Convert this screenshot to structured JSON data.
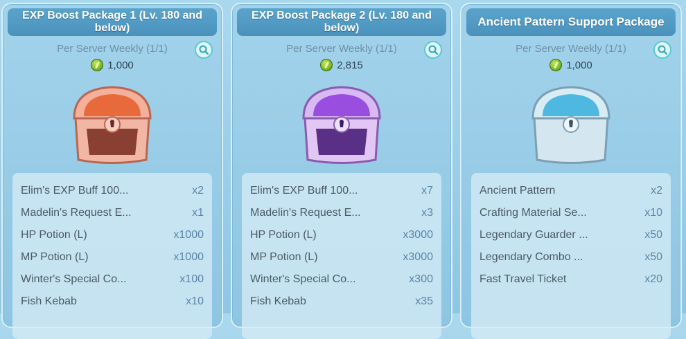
{
  "packages": [
    {
      "title": "EXP Boost Package 1 (Lv. 180 and below)",
      "limit": "Per Server Weekly (1/1)",
      "price": "1,000",
      "chest_color": "#f08060",
      "items": [
        {
          "name": "Elim's EXP Buff 100...",
          "qty": "x2"
        },
        {
          "name": "Madelin's Request E...",
          "qty": "x1"
        },
        {
          "name": "HP Potion (L)",
          "qty": "x1000"
        },
        {
          "name": "MP Potion (L)",
          "qty": "x1000"
        },
        {
          "name": "Winter's Special Co...",
          "qty": "x100"
        },
        {
          "name": "Fish Kebab",
          "qty": "x10"
        }
      ]
    },
    {
      "title": "EXP Boost Package 2 (Lv. 180 and below)",
      "limit": "Per Server Weekly (1/1)",
      "price": "2,815",
      "chest_color": "#b670e6",
      "items": [
        {
          "name": "Elim's EXP Buff 100...",
          "qty": "x7"
        },
        {
          "name": "Madelin's Request E...",
          "qty": "x3"
        },
        {
          "name": "HP Potion (L)",
          "qty": "x3000"
        },
        {
          "name": "MP Potion (L)",
          "qty": "x3000"
        },
        {
          "name": "Winter's Special Co...",
          "qty": "x300"
        },
        {
          "name": "Fish Kebab",
          "qty": "x35"
        }
      ]
    },
    {
      "title": "Ancient Pattern Support Package",
      "limit": "Per Server Weekly (1/1)",
      "price": "1,000",
      "chest_color": "#60c4e8",
      "items": [
        {
          "name": "Ancient Pattern",
          "qty": "x2"
        },
        {
          "name": "Crafting Material Se...",
          "qty": "x10"
        },
        {
          "name": "Legendary Guarder ...",
          "qty": "x50"
        },
        {
          "name": "Legendary Combo ...",
          "qty": "x50"
        },
        {
          "name": "Fast Travel Ticket",
          "qty": "x20"
        }
      ]
    }
  ],
  "icons": {
    "zoom": "magnifier-icon",
    "currency": "green-gem-coin-icon"
  }
}
